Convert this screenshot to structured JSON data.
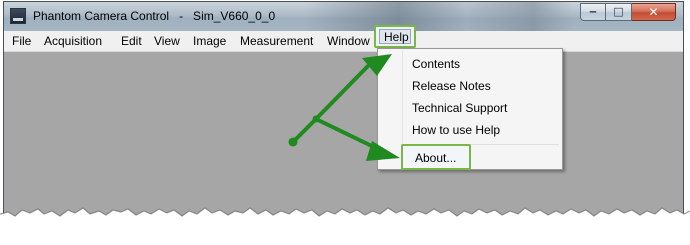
{
  "window": {
    "title": "Phantom Camera Control   -   Sim_V660_0_0"
  },
  "menubar": {
    "items": [
      "File",
      "Acquisition",
      "Edit",
      "View",
      "Image",
      "Measurement",
      "Window",
      "Help"
    ]
  },
  "help_menu": {
    "items": [
      "Contents",
      "Release Notes",
      "Technical Support",
      "How to use Help",
      "About..."
    ]
  },
  "colors": {
    "annotation_green": "#1f8a1f",
    "highlight_border": "#7ab648",
    "workspace_gray": "#a6a6a6"
  },
  "icons": [
    "app-icon",
    "minimize-icon",
    "maximize-icon",
    "close-icon"
  ]
}
